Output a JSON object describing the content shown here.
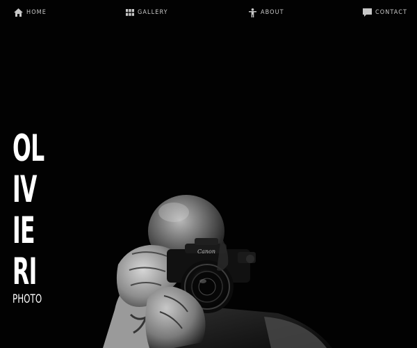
{
  "nav": {
    "items": [
      {
        "id": "home",
        "label": "HOME",
        "icon": "home-icon"
      },
      {
        "id": "gallery",
        "label": "GALLERY",
        "icon": "grid-icon"
      },
      {
        "id": "about",
        "label": "ABOUT",
        "icon": "person-icon"
      },
      {
        "id": "contact",
        "label": "CONTACT",
        "icon": "speech-bubble-icon"
      }
    ]
  },
  "logo": {
    "lines": [
      "OL",
      "IV",
      "IE",
      "RI"
    ],
    "subtitle": "PHOTO"
  },
  "hero": {
    "camera_brand": "Canon"
  },
  "colors": {
    "background": "#020202",
    "nav_text": "#c8c8c8",
    "logo_text": "#ffffff"
  }
}
